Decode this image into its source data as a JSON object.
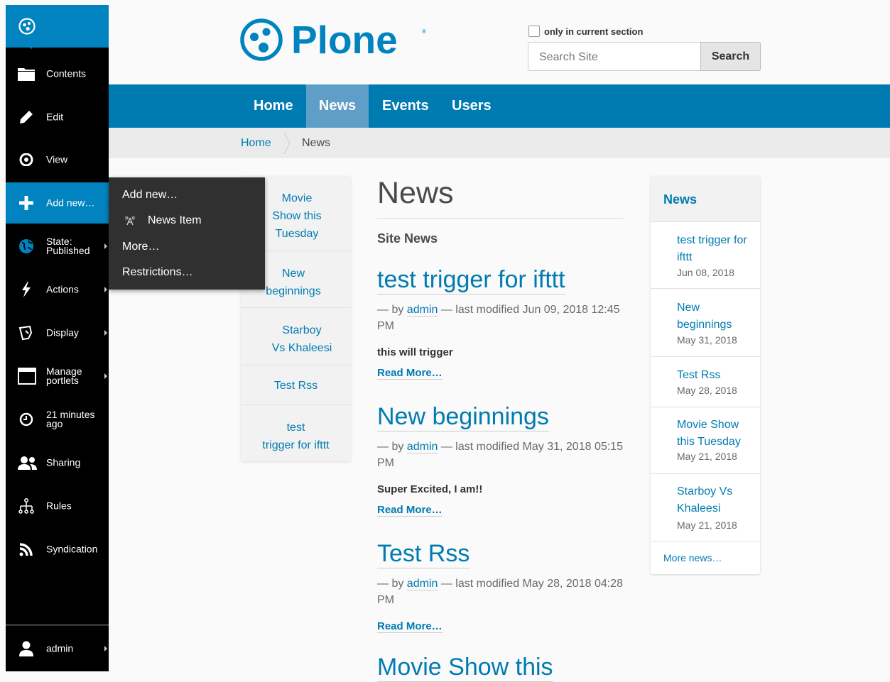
{
  "toolbar": {
    "items": [
      {
        "label": "Contents",
        "icon": "folder-icon"
      },
      {
        "label": "Edit",
        "icon": "pencil-icon"
      },
      {
        "label": "View",
        "icon": "eye-icon"
      },
      {
        "label": "Add new…",
        "icon": "plus-icon"
      },
      {
        "label_line1": "State:",
        "label_line2": "Published",
        "icon": "globe-icon"
      },
      {
        "label": "Actions",
        "icon": "bolt-icon"
      },
      {
        "label": "Display",
        "icon": "display-icon"
      },
      {
        "label_line1": "Manage",
        "label_line2": "portlets",
        "icon": "window-icon"
      },
      {
        "label_line1": "21 minutes",
        "label_line2": "ago",
        "icon": "clock-icon"
      },
      {
        "label": "Sharing",
        "icon": "users-icon"
      },
      {
        "label": "Rules",
        "icon": "sitemap-icon"
      },
      {
        "label": "Syndication",
        "icon": "rss-icon"
      }
    ],
    "user": {
      "label": "admin",
      "icon": "user-icon"
    },
    "accent": "#0083be"
  },
  "add_new_menu": {
    "header": "Add new…",
    "news_item": "News Item",
    "more": "More…",
    "restrictions": "Restrictions…"
  },
  "header": {
    "logo_text": "Plone",
    "search_checkbox_label": "only in current section",
    "search_placeholder": "Search Site",
    "search_button": "Search"
  },
  "nav": {
    "items": [
      "Home",
      "News",
      "Events",
      "Users"
    ],
    "selected": "News",
    "color": "#007bb1"
  },
  "breadcrumb": [
    "Home",
    "News"
  ],
  "left_portlet": {
    "items": [
      {
        "line1": "Movie",
        "line2": "Show this",
        "line3": "Tuesday"
      },
      {
        "line1": "New",
        "line2": "beginnings"
      },
      {
        "line1": "Starboy",
        "line2": "Vs Khaleesi"
      },
      {
        "line1": "Test Rss"
      },
      {
        "line1": "test",
        "line2": "trigger for ifttt"
      }
    ]
  },
  "main": {
    "title": "News",
    "section": "Site News",
    "articles": [
      {
        "title": "test trigger for ifttt",
        "by_prefix": "— by",
        "author": "admin",
        "modified": "— last modified Jun 09, 2018 12:45 PM",
        "description": "this will trigger",
        "read_more": "Read More…"
      },
      {
        "title": "New beginnings",
        "by_prefix": "— by",
        "author": "admin",
        "modified": "— last modified May 31, 2018 05:15 PM",
        "description": "Super Excited, I am!!",
        "read_more": "Read More…"
      },
      {
        "title": "Test Rss",
        "by_prefix": "— by",
        "author": "admin",
        "modified": "— last modified May 28, 2018 04:28 PM",
        "description": "",
        "read_more": "Read More…"
      },
      {
        "title": "Movie Show this"
      }
    ]
  },
  "right_portlet": {
    "title": "News",
    "items": [
      {
        "title": "test trigger for ifttt",
        "date": "Jun 08, 2018"
      },
      {
        "title": "New beginnings",
        "date": "May 31, 2018"
      },
      {
        "title": "Test Rss",
        "date": "May 28, 2018"
      },
      {
        "title": "Movie Show this Tuesday",
        "date": "May 21, 2018"
      },
      {
        "title": "Starboy Vs Khaleesi",
        "date": "May 21, 2018"
      }
    ],
    "more": "More news…"
  }
}
